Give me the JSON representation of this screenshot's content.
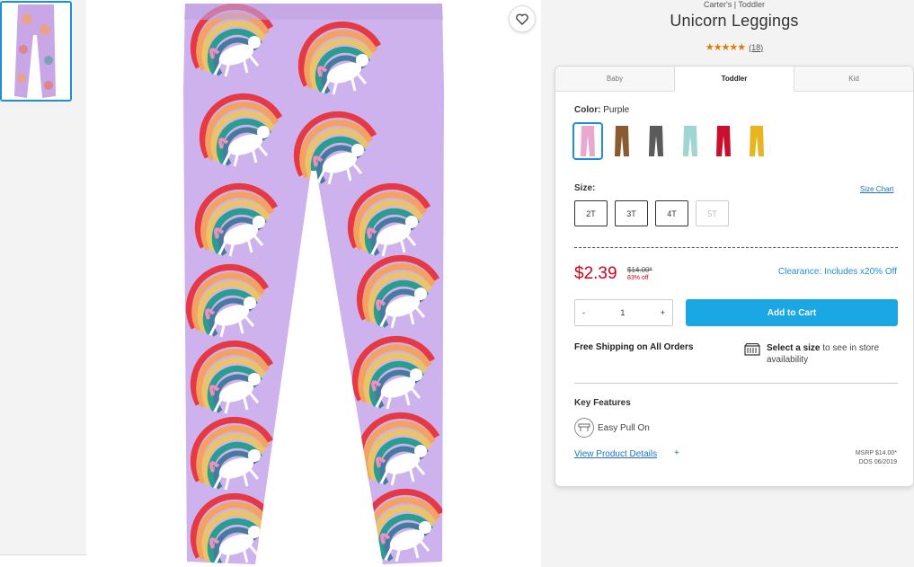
{
  "product": {
    "brand": "Carter's | Toddler",
    "title": "Unicorn Leggings",
    "stars": "★★★★★",
    "review_count": "(18)"
  },
  "tabs": [
    "Baby",
    "Toddler",
    "Kid"
  ],
  "color": {
    "label": "Color:",
    "value": "Purple",
    "swatches": [
      {
        "name": "Purple unicorn",
        "color": "#e8a9cf"
      },
      {
        "name": "Brown",
        "color": "#8a5a32"
      },
      {
        "name": "Gray print",
        "color": "#5a5a5a"
      },
      {
        "name": "Mint print",
        "color": "#9fd6d1"
      },
      {
        "name": "Red",
        "color": "#c8102e"
      },
      {
        "name": "Yellow",
        "color": "#e6b520"
      }
    ]
  },
  "size": {
    "label": "Size:",
    "chart_link": "Size Chart",
    "options": [
      "2T",
      "3T",
      "4T",
      "5T"
    ]
  },
  "pricing": {
    "price": "$2.39",
    "original": "$14.00*",
    "percent_off": "83% off",
    "clearance": "Clearance: Includes x20% Off"
  },
  "quantity": {
    "minus": "-",
    "value": "1",
    "plus": "+"
  },
  "add_to_cart": "Add to Cart",
  "shipping": "Free Shipping on All Orders",
  "store": {
    "bold": "Select a size",
    "rest": " to see in store availability"
  },
  "features": {
    "heading": "Key Features",
    "item": "Easy Pull On"
  },
  "details_link": "View Product Details",
  "details_plus": "+",
  "msrp": {
    "line1": "MSRP $14.00*",
    "line2": "DOS 06/2019"
  },
  "colors": {
    "accent": "#1aa7e3",
    "link": "#1c73c9",
    "price": "#d0021b",
    "legging": "#c9a6e6"
  }
}
